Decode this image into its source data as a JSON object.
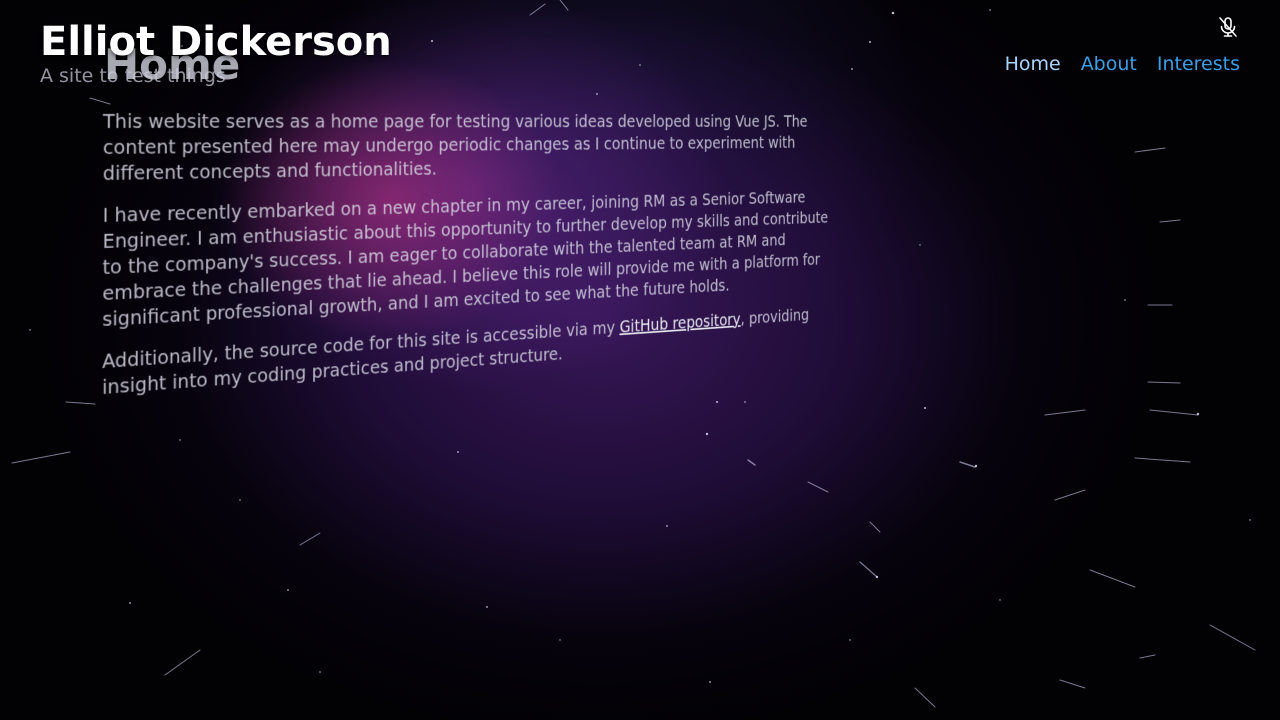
{
  "site": {
    "title": "Elliot Dickerson",
    "subtitle": "A site to test things"
  },
  "nav": {
    "items": [
      {
        "label": "Home",
        "active": true
      },
      {
        "label": "About",
        "active": false
      },
      {
        "label": "Interests",
        "active": false
      }
    ]
  },
  "mic_button": {
    "icon": "microphone-off-icon"
  },
  "page": {
    "heading": "Home",
    "paragraphs": [
      {
        "text": "This website serves as a home page for testing various ideas developed using Vue JS. The content presented here may undergo periodic changes as I continue to experiment with different concepts and functionalities."
      },
      {
        "text": "I have recently embarked on a new chapter in my career, joining RM as a Senior Software Engineer. I am enthusiastic about this opportunity to further develop my skills and contribute to the company's success. I am eager to collaborate with the talented team at RM and embrace the challenges that lie ahead. I believe this role will provide me with a platform for significant professional growth, and I am excited to see what the future holds."
      },
      {
        "before_link": "Additionally, the source code for this site is accessible via my ",
        "link_text": "GitHub repository",
        "after_link": ", providing insight into my coding practices and project structure."
      }
    ]
  },
  "colors": {
    "background": "#020104",
    "nebula_pink": "#be3282",
    "nebula_purple": "#3a185c",
    "nav_link": "#3a9fe6",
    "nav_active": "#a9d4ff"
  }
}
